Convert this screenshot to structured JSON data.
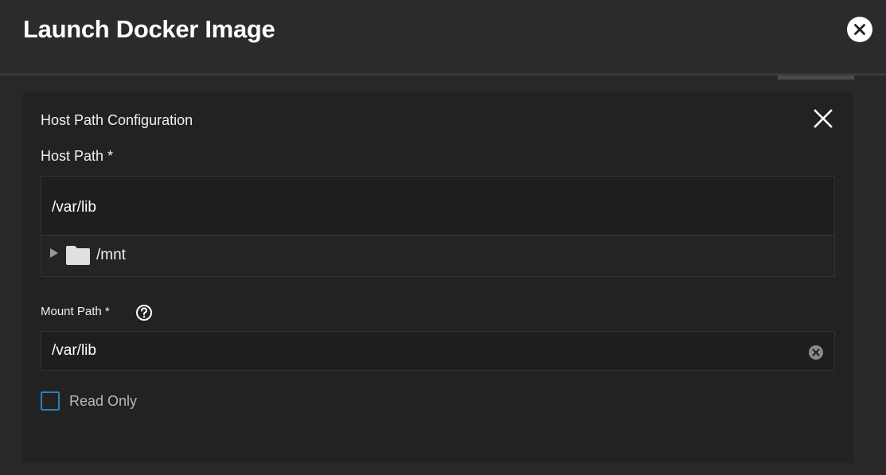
{
  "dialog": {
    "title": "Launch Docker Image",
    "close_icon": "close-circle-icon"
  },
  "panel": {
    "title": "Host Path Configuration",
    "close_icon": "close-icon",
    "host_path": {
      "label": "Host Path *",
      "value": "/var/lib",
      "tree": [
        {
          "label": "/mnt",
          "expand_icon": "triangle-right-icon",
          "icon": "folder-icon"
        }
      ]
    },
    "mount_path": {
      "label": "Mount Path *",
      "help_icon": "help-circle-icon",
      "value": "/var/lib",
      "clear_icon": "clear-circle-icon"
    },
    "read_only": {
      "label": "Read Only",
      "checked": false
    }
  },
  "colors": {
    "background": "#282828",
    "panel": "#222222",
    "input": "#1e1e1e",
    "checkbox_border": "#2e7fb8",
    "text": "#f0f0f0"
  }
}
